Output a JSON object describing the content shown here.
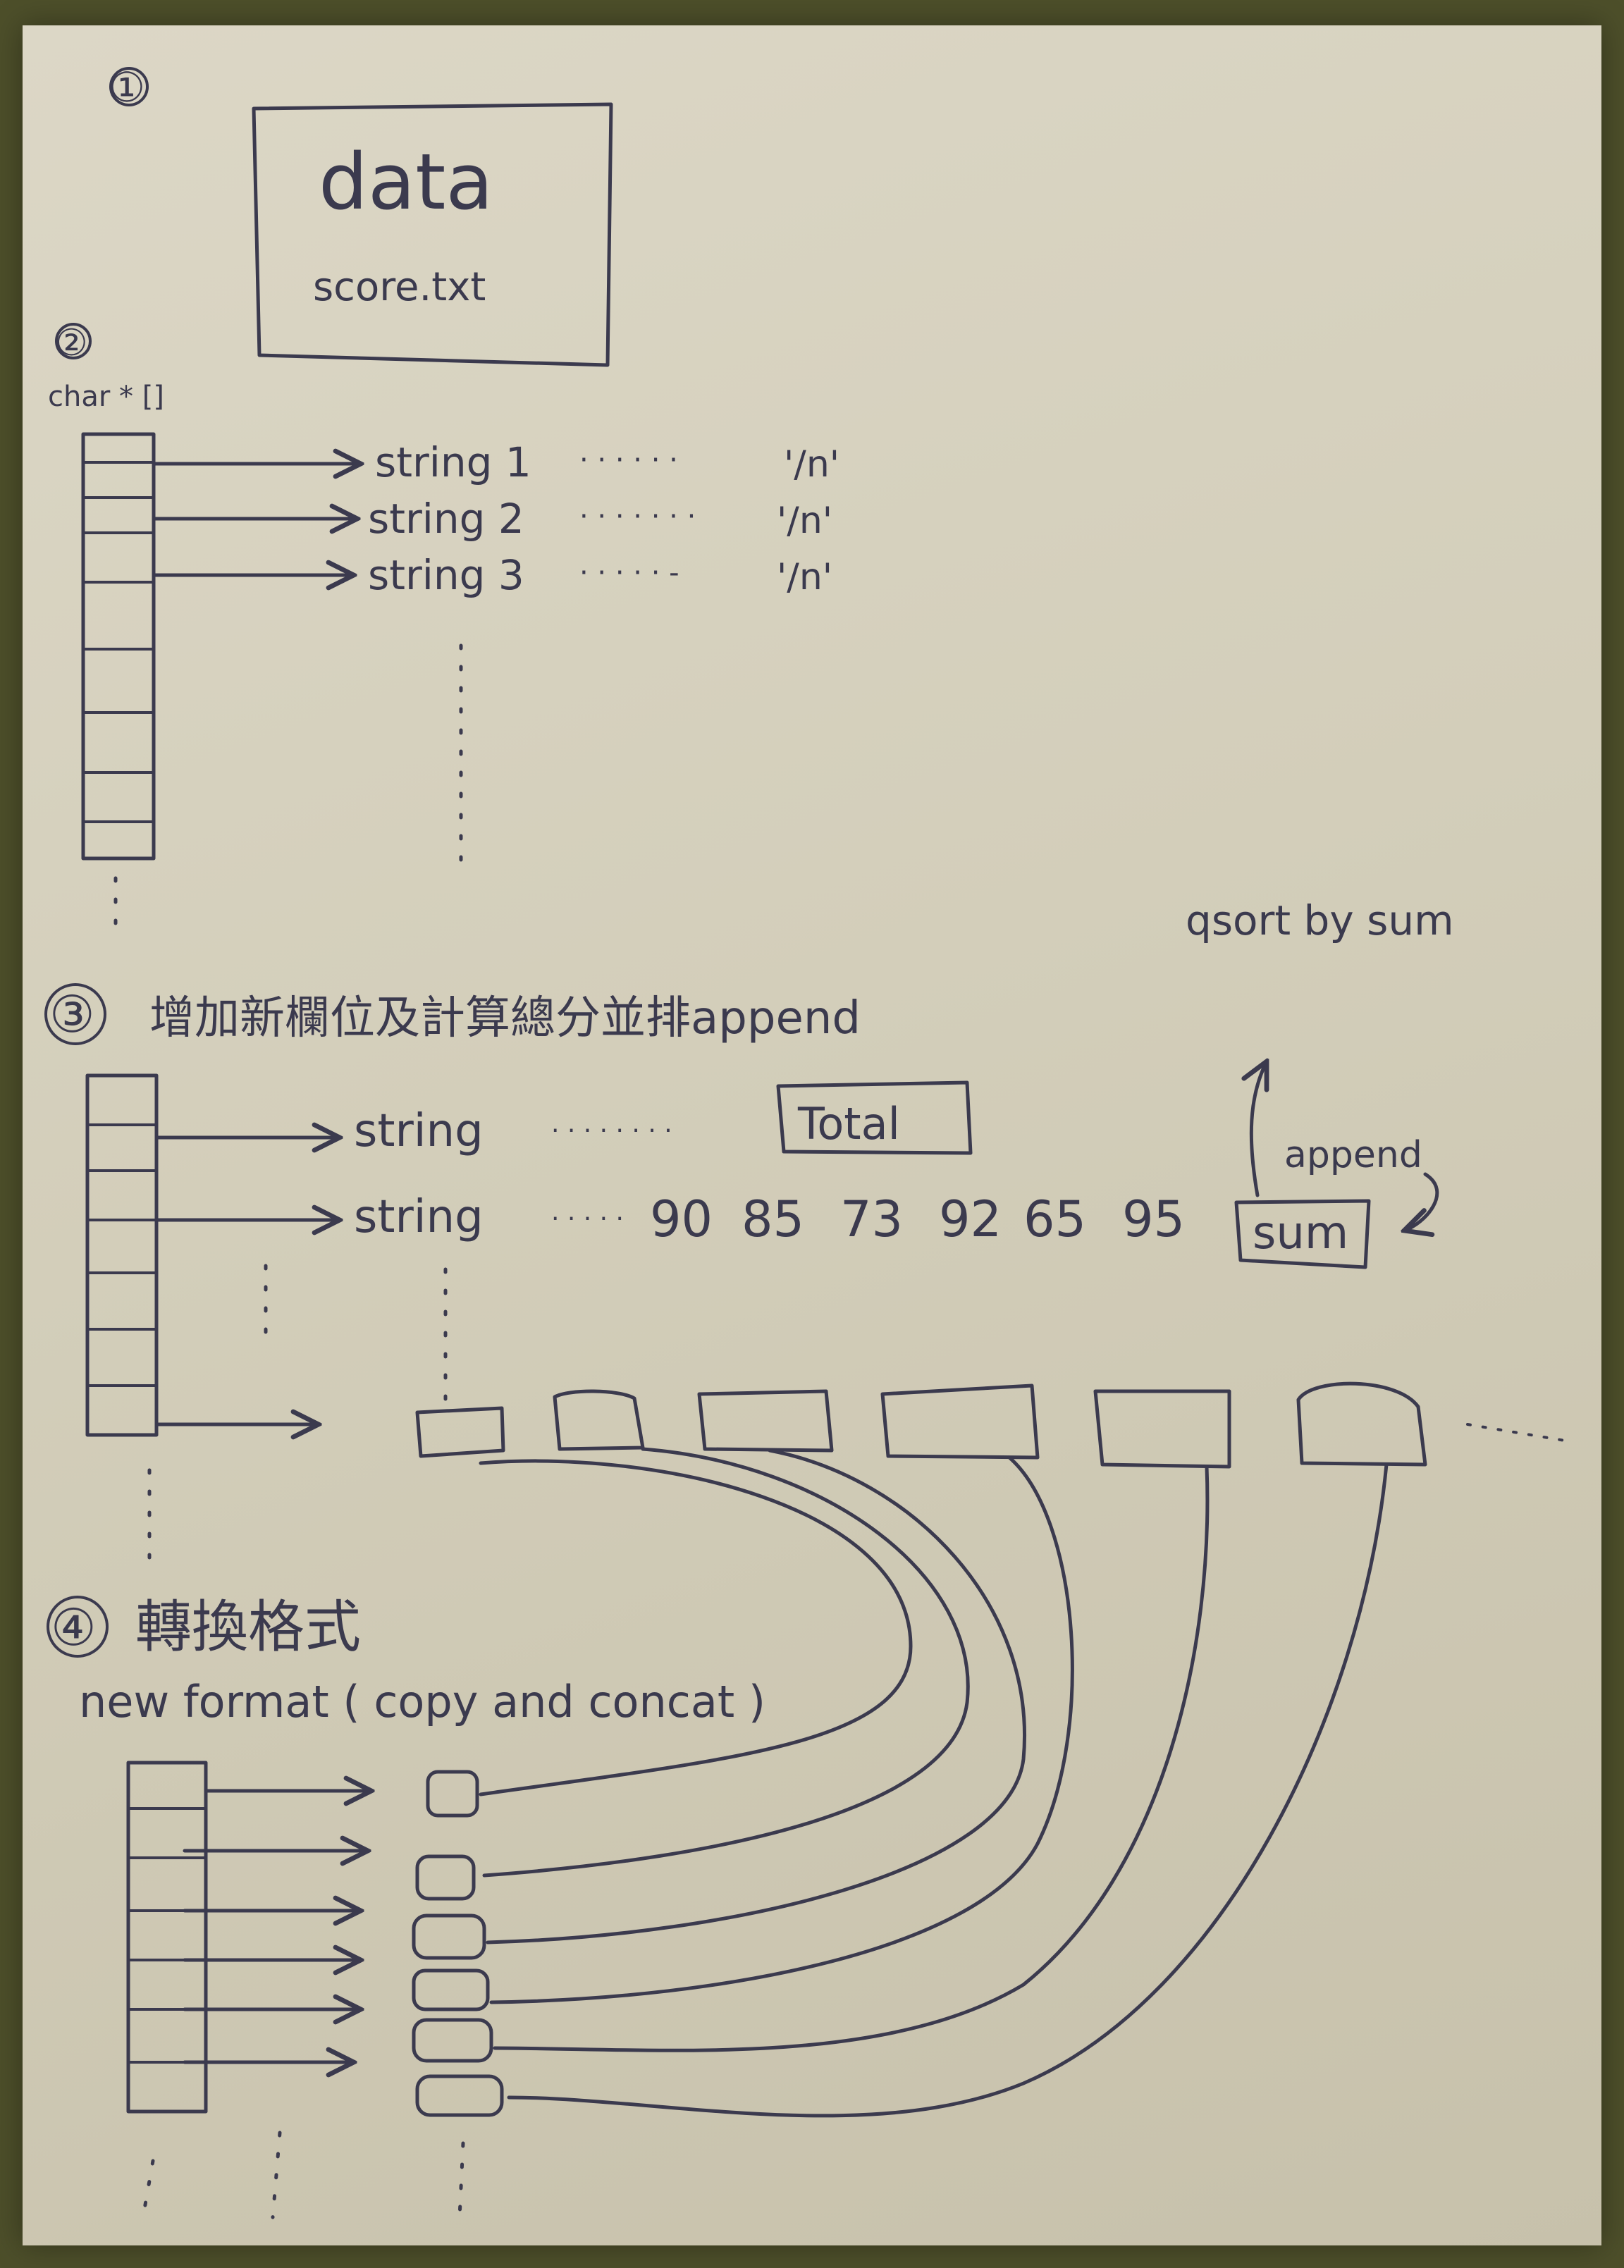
{
  "sections": {
    "s1": {
      "number": "①",
      "box_title": "data",
      "box_file": "score.txt"
    },
    "s2": {
      "number": "②",
      "type_label": "char * []",
      "rows": [
        {
          "label": "string 1",
          "dots": "· · · · · ·",
          "newline": "'/n'"
        },
        {
          "label": "string 2",
          "dots": "· · · · · · ·",
          "newline": "'/n'"
        },
        {
          "label": "string 3",
          "dots": "· · · · · -",
          "newline": "'/n'"
        }
      ]
    },
    "s3": {
      "number": "③",
      "title": "增加新欄位及計算總分並排append",
      "rows": [
        {
          "label": "string",
          "dots": "· · · ·   · · · ·"
        },
        {
          "label": "string",
          "dots": "· · · · ·"
        }
      ],
      "total_label": "Total",
      "scores": [
        "90",
        "85",
        "73",
        "92",
        "65",
        "95"
      ],
      "sum_label": "sum",
      "append_note": "append",
      "qsort_note": "qsort  by  sum"
    },
    "s4": {
      "number": "④",
      "title": "轉換格式",
      "subtitle": "new  format   ( copy  and  concat )"
    }
  }
}
